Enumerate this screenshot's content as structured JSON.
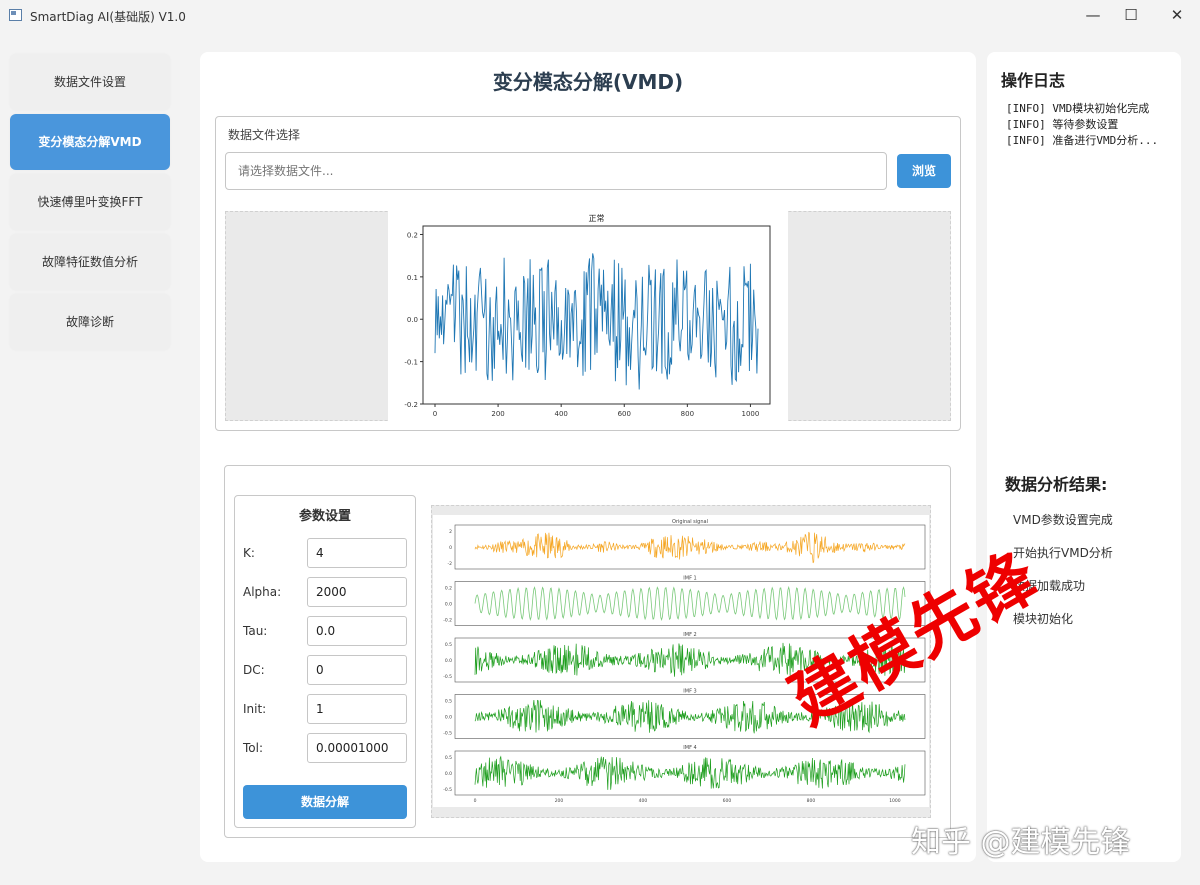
{
  "window": {
    "title": "SmartDiag AI(基础版) V1.0",
    "minimize": "—",
    "maximize": "☐",
    "close": "✕"
  },
  "sidebar": {
    "items": [
      {
        "label": "数据文件设置"
      },
      {
        "label": "变分模态分解VMD"
      },
      {
        "label": "快速傅里叶变换FFT"
      },
      {
        "label": "故障特征数值分析"
      },
      {
        "label": "故障诊断"
      }
    ]
  },
  "main": {
    "title": "变分模态分解(VMD)",
    "file": {
      "group_label": "数据文件选择",
      "placeholder": "请选择数据文件...",
      "browse_label": "浏览"
    },
    "params": {
      "title": "参数设置",
      "fields": [
        {
          "label": "K:",
          "value": "4"
        },
        {
          "label": "Alpha:",
          "value": "2000"
        },
        {
          "label": "Tau:",
          "value": "0.0"
        },
        {
          "label": "DC:",
          "value": "0"
        },
        {
          "label": "Init:",
          "value": "1"
        },
        {
          "label": "Tol:",
          "value": "0.00001000"
        }
      ],
      "submit_label": "数据分解"
    }
  },
  "log": {
    "title": "操作日志",
    "lines": [
      "[INFO] VMD模块初始化完成",
      "[INFO] 等待参数设置",
      "[INFO] 准备进行VMD分析..."
    ]
  },
  "results": {
    "title": "数据分析结果:",
    "items": [
      "VMD参数设置完成",
      "开始执行VMD分析",
      "数据加载成功",
      "模块初始化"
    ]
  },
  "watermark": {
    "main": "建模先锋",
    "footer": "知乎 @建模先锋"
  },
  "chart_data": [
    {
      "type": "line",
      "title": "正常",
      "x": [
        0,
        1024
      ],
      "ylim": [
        -0.2,
        0.22
      ],
      "xticks": [
        "0",
        "200",
        "400",
        "600",
        "800",
        "1000"
      ],
      "yticks": [
        "0.2",
        "0.1",
        "0.0",
        "-0.1",
        "-0.2"
      ],
      "series": [
        {
          "color": "#1f77b4"
        }
      ]
    },
    {
      "type": "line",
      "panels": [
        {
          "title": "Original signal",
          "color": "#f5a623",
          "yticks": [
            "2",
            "0",
            "-2"
          ]
        },
        {
          "title": "IMF 1",
          "color": "#7ac97a",
          "yticks": [
            "0.2",
            "0.0",
            "-0.2"
          ]
        },
        {
          "title": "IMF 2",
          "color": "#1e9e1e",
          "yticks": [
            "0.5",
            "0.0",
            "-0.5"
          ]
        },
        {
          "title": "IMF 3",
          "color": "#1e9e1e",
          "yticks": [
            "0.5",
            "0.0",
            "-0.5"
          ]
        },
        {
          "title": "IMF 4",
          "color": "#1e9e1e",
          "yticks": [
            "0.5",
            "0.0",
            "-0.5"
          ]
        }
      ],
      "xticks": [
        "0",
        "200",
        "400",
        "600",
        "800",
        "1000"
      ]
    }
  ]
}
